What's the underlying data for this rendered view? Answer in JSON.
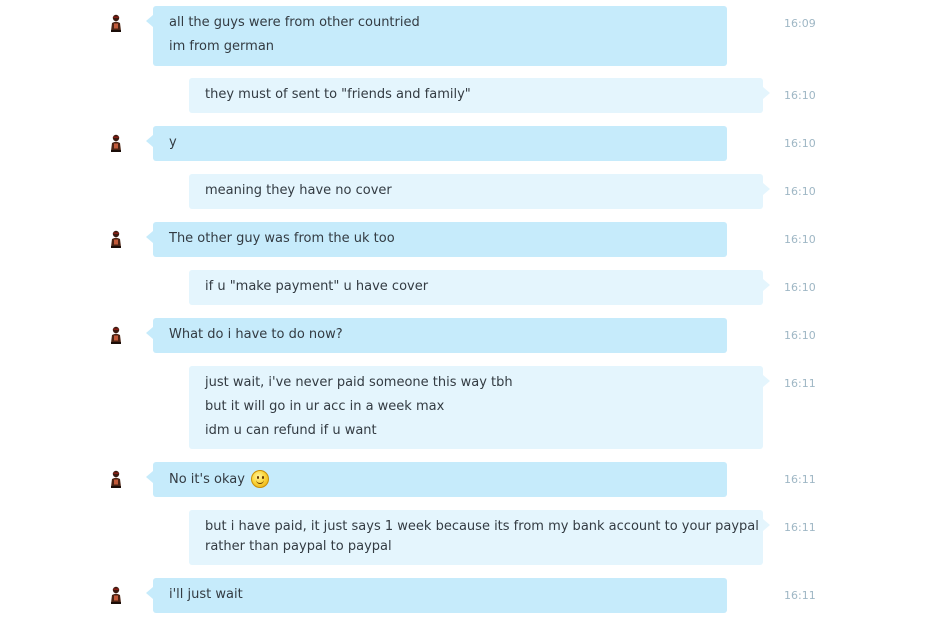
{
  "conversation": {
    "messages": [
      {
        "from": "contact",
        "lines": [
          "all the guys were from other countried",
          "im from german"
        ],
        "time": "16:09"
      },
      {
        "from": "me",
        "lines": [
          "they must of sent to \"friends and family\""
        ],
        "time": "16:10"
      },
      {
        "from": "contact",
        "lines": [
          "y"
        ],
        "time": "16:10"
      },
      {
        "from": "me",
        "lines": [
          "meaning they have no cover"
        ],
        "time": "16:10"
      },
      {
        "from": "contact",
        "lines": [
          "The other guy was from the uk too"
        ],
        "time": "16:10"
      },
      {
        "from": "me",
        "lines": [
          "if u \"make payment\" u have cover"
        ],
        "time": "16:10"
      },
      {
        "from": "contact",
        "lines": [
          "What do i have to do now?"
        ],
        "time": "16:10"
      },
      {
        "from": "me",
        "lines": [
          "just wait, i've never paid someone this way tbh",
          "but it will go in ur acc in a week max",
          "idm u can refund if u want"
        ],
        "time": "16:11"
      },
      {
        "from": "contact",
        "lines": [
          "No it's okay"
        ],
        "emoji": "smile-emoji",
        "time": "16:11"
      },
      {
        "from": "me",
        "lines": [
          "but i have paid, it just says 1 week because its from my bank account to your paypal",
          "rather than paypal to paypal"
        ],
        "time": "16:11"
      },
      {
        "from": "contact",
        "lines": [
          "i'll just wait"
        ],
        "time": "16:11"
      }
    ]
  },
  "theme": {
    "incoming_bubble": "#c6ebfb",
    "outgoing_bubble": "#e4f5fd",
    "timestamp_color": "#9fb7c5",
    "text_color": "#333b42"
  },
  "icons": {
    "avatar": "contact-avatar-icon",
    "emoji": "smile-emoji-icon"
  }
}
